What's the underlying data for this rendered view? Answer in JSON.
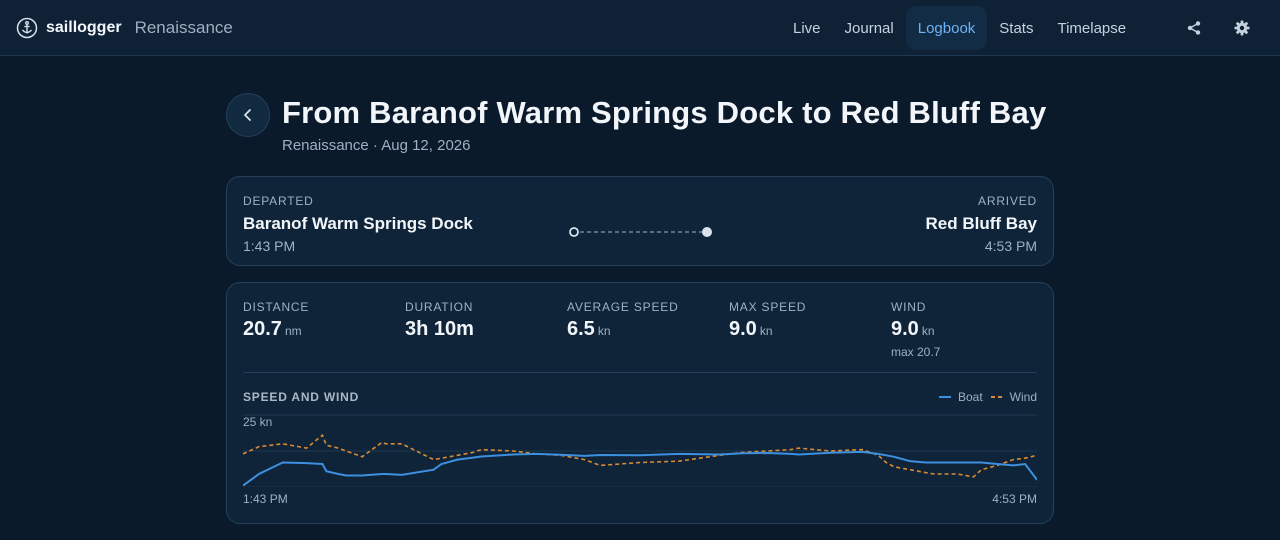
{
  "app": {
    "brand": "saillogger",
    "boat_name": "Renaissance",
    "nav": [
      {
        "label": "Live",
        "active": false
      },
      {
        "label": "Journal",
        "active": false
      },
      {
        "label": "Logbook",
        "active": true
      },
      {
        "label": "Stats",
        "active": false
      },
      {
        "label": "Timelapse",
        "active": false
      }
    ],
    "icons": {
      "logo": "anchor-icon",
      "share": "share-icon",
      "settings": "gear-icon",
      "back": "chevron-left-icon"
    }
  },
  "trip": {
    "title": "From Baranof Warm Springs Dock to Red Bluff Bay",
    "subtitle": "Renaissance · Aug 12, 2026",
    "departed": {
      "label": "DEPARTED",
      "place": "Baranof Warm Springs Dock",
      "time": "1:43 PM"
    },
    "arrived": {
      "label": "ARRIVED",
      "place": "Red Bluff Bay",
      "time": "4:53 PM"
    }
  },
  "stats": [
    {
      "label": "DISTANCE",
      "value": "20.7",
      "unit": "nm",
      "sub": ""
    },
    {
      "label": "DURATION",
      "value": "3h 10m",
      "unit": "",
      "sub": ""
    },
    {
      "label": "AVERAGE SPEED",
      "value": "6.5",
      "unit": "kn",
      "sub": ""
    },
    {
      "label": "MAX SPEED",
      "value": "9.0",
      "unit": "kn",
      "sub": ""
    },
    {
      "label": "WIND",
      "value": "9.0",
      "unit": "kn",
      "sub": "max 20.7"
    }
  ],
  "chart": {
    "title": "SPEED AND WIND",
    "y_max_label": "25 kn",
    "x_start_label": "1:43 PM",
    "x_end_label": "4:53 PM"
  },
  "colors": {
    "boat": "#3d8fe0",
    "wind": "#d98a35",
    "accent": "#6db3f5",
    "background": "#0a1a2b",
    "card": "#0f2438"
  },
  "chart_data": {
    "type": "line",
    "title": "SPEED AND WIND",
    "xlabel": "",
    "ylabel": "",
    "x_range": [
      "1:43 PM",
      "4:53 PM"
    ],
    "ylim": [
      0,
      25
    ],
    "y_unit": "kn",
    "grid": true,
    "legend": "top-right",
    "x": [
      0,
      0.02,
      0.05,
      0.08,
      0.1,
      0.105,
      0.12,
      0.13,
      0.15,
      0.175,
      0.18,
      0.2,
      0.24,
      0.25,
      0.27,
      0.29,
      0.3,
      0.34,
      0.37,
      0.4,
      0.43,
      0.45,
      0.5,
      0.55,
      0.6,
      0.63,
      0.66,
      0.69,
      0.7,
      0.74,
      0.78,
      0.8,
      0.81,
      0.82,
      0.84,
      0.86,
      0.87,
      0.9,
      0.92,
      0.93,
      0.95,
      0.97,
      0.985,
      1.0
    ],
    "series": [
      {
        "name": "Boat",
        "style": "solid",
        "values": [
          0.5,
          4.5,
          8.5,
          8.3,
          8.0,
          5.5,
          4.5,
          4.0,
          4.0,
          4.5,
          4.5,
          4.2,
          6.0,
          8.0,
          9.5,
          10.2,
          10.6,
          11.3,
          11.5,
          11.2,
          10.8,
          11.1,
          11.0,
          11.5,
          11.3,
          11.7,
          11.8,
          11.5,
          11.3,
          11.9,
          12.2,
          11.5,
          11.0,
          10.5,
          9.0,
          8.5,
          8.5,
          8.5,
          8.5,
          8.5,
          8.0,
          7.5,
          8.0,
          2.5
        ]
      },
      {
        "name": "Wind",
        "style": "dashed",
        "values": [
          11.5,
          14.0,
          15.0,
          13.5,
          18.0,
          14.5,
          13.5,
          12.5,
          10.5,
          15.5,
          15.0,
          15.0,
          9.5,
          10.0,
          11.0,
          12.0,
          13.0,
          12.5,
          11.5,
          11.0,
          9.5,
          7.5,
          8.5,
          9.0,
          11.0,
          12.0,
          12.5,
          13.0,
          13.5,
          12.5,
          13.0,
          11.0,
          8.5,
          7.0,
          6.0,
          5.0,
          4.5,
          4.5,
          3.5,
          6.0,
          7.5,
          9.5,
          10.0,
          11.0
        ]
      }
    ]
  }
}
